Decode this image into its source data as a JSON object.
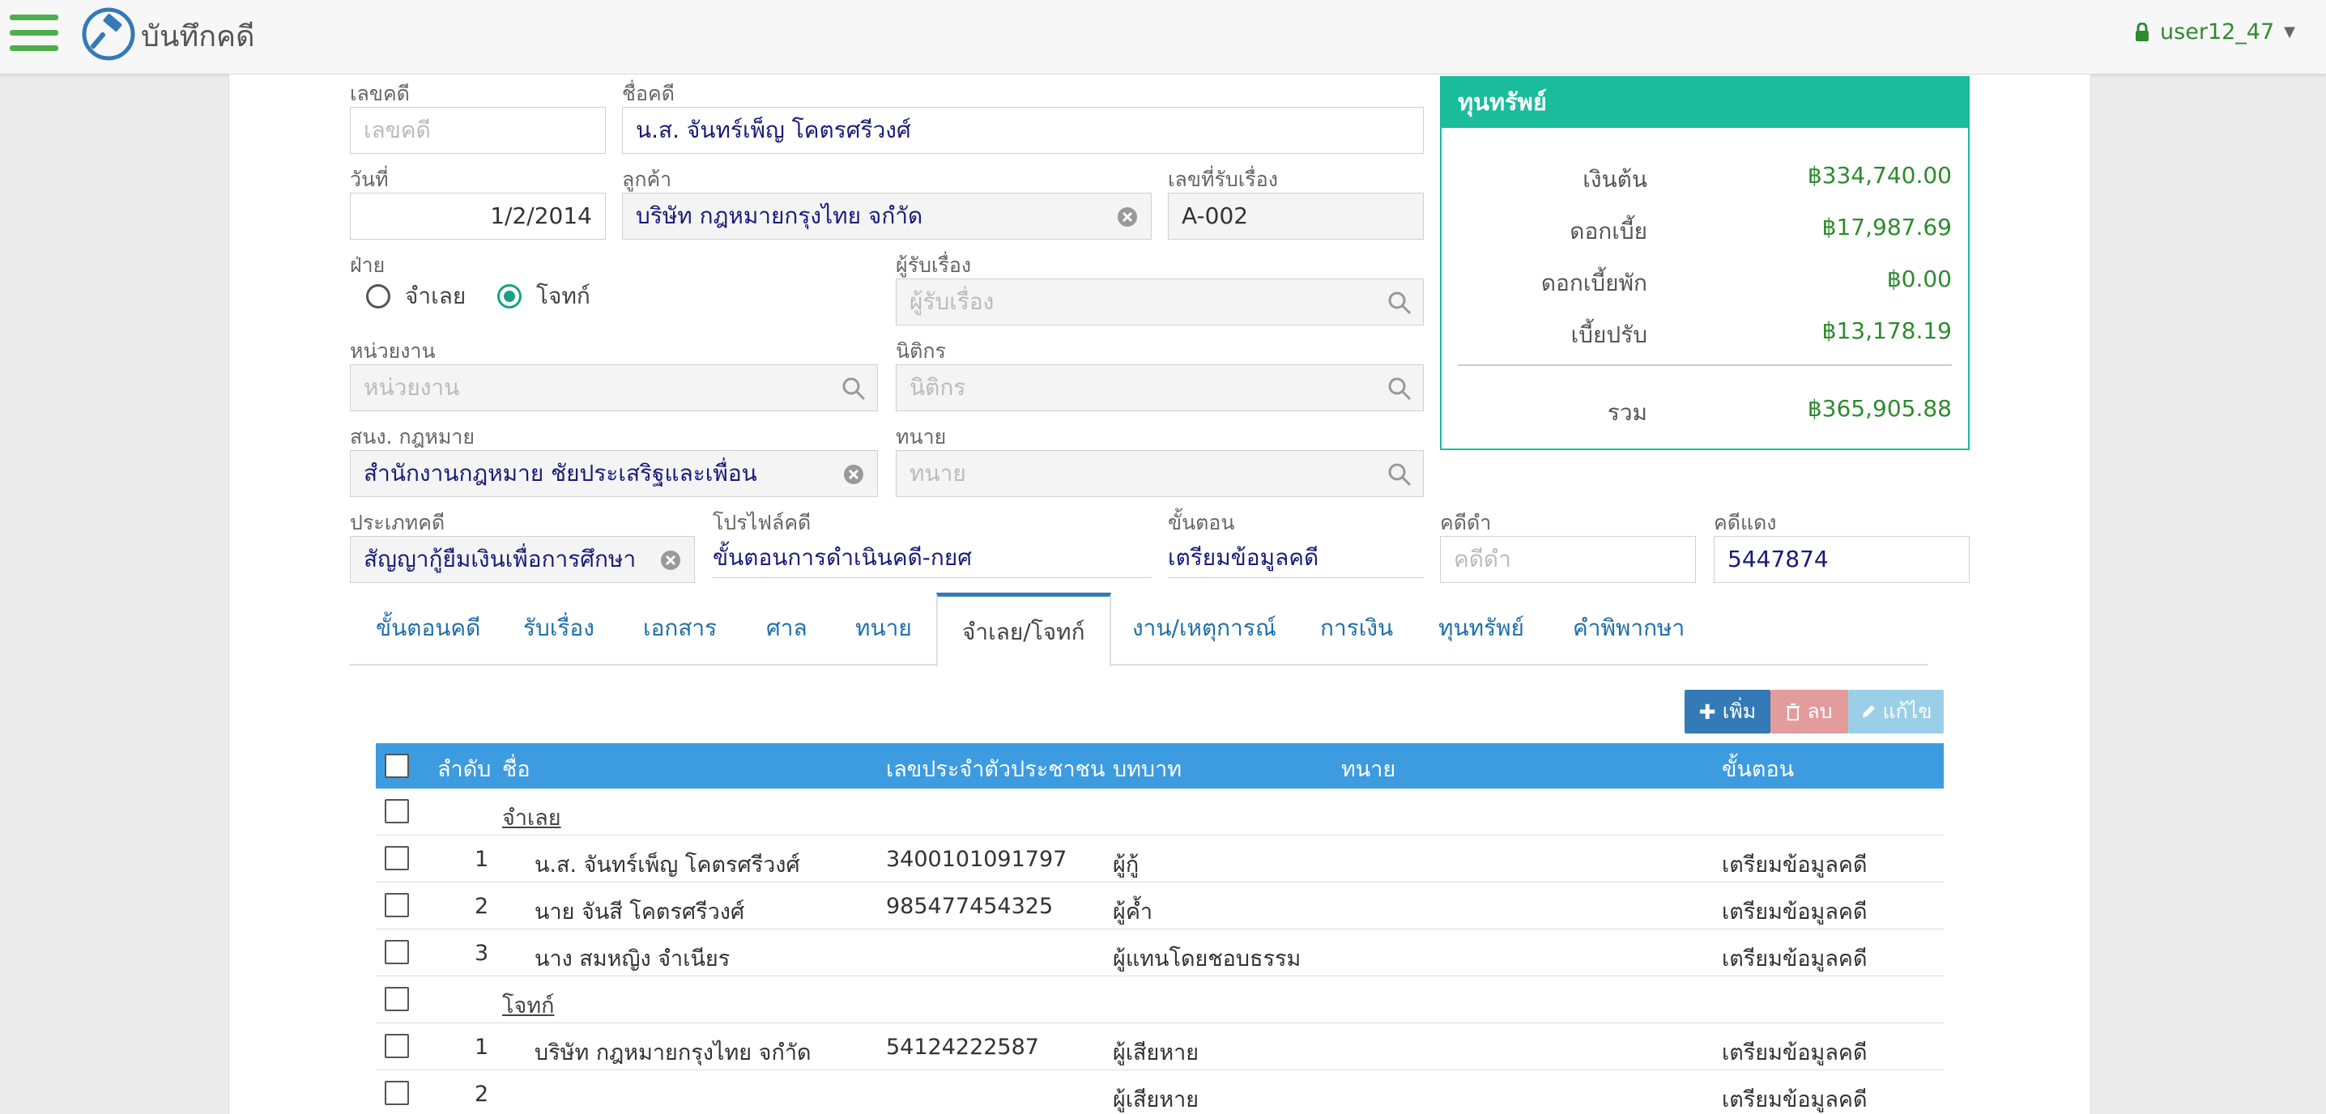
{
  "header": {
    "title": "บันทึกคดี",
    "user": "user12_47"
  },
  "form": {
    "case_no": {
      "label": "เลขคดี",
      "placeholder": "เลขคดี",
      "value": ""
    },
    "case_name": {
      "label": "ชื่อคดี",
      "value": "น.ส. จันทร์เพ็ญ โคตรศรีวงศ์"
    },
    "date": {
      "label": "วันที่",
      "value": "1/2/2014"
    },
    "client": {
      "label": "ลูกค้า",
      "value": "บริษัท กฎหมายกรุงไทย จกำัด"
    },
    "receive_no": {
      "label": "เลขที่รับเรื่อง",
      "value": "A-002"
    },
    "side": {
      "label": "ฝ่าย",
      "options": [
        "จำเลย",
        "โจทก์"
      ],
      "selected": "โจทก์"
    },
    "receiver": {
      "label": "ผู้รับเรื่อง",
      "placeholder": "ผู้รับเรื่อง"
    },
    "unit": {
      "label": "หน่วยงาน",
      "placeholder": "หน่วยงาน"
    },
    "legal_officer": {
      "label": "นิติกร",
      "placeholder": "นิติกร"
    },
    "law_office": {
      "label": "สนง. กฎหมาย",
      "value": "สำนักงานกฎหมาย ชัยประเสริฐและเพื่อน"
    },
    "lawyer": {
      "label": "ทนาย",
      "placeholder": "ทนาย"
    },
    "case_type": {
      "label": "ประเภทคดี",
      "value": "สัญญากู้ยืมเงินเพื่อการศึกษา"
    },
    "case_profile": {
      "label": "โปรไฟล์คดี",
      "value": "ขั้นตอนการดำเนินคดี-กยศ"
    },
    "step": {
      "label": "ขั้นตอน",
      "value": "เตรียมข้อมูลคดี"
    },
    "black_case": {
      "label": "คดีดำ",
      "placeholder": "คดีดำ"
    },
    "red_case": {
      "label": "คดีแดง",
      "value": "5447874"
    }
  },
  "assets": {
    "title": "ทุนทรัพย์",
    "rows": [
      {
        "label": "เงินต้น",
        "value": "฿334,740.00"
      },
      {
        "label": "ดอกเบี้ย",
        "value": "฿17,987.69"
      },
      {
        "label": "ดอกเบี้ยพัก",
        "value": "฿0.00"
      },
      {
        "label": "เบี้ยปรับ",
        "value": "฿13,178.19"
      }
    ],
    "total": {
      "label": "รวม",
      "value": "฿365,905.88"
    }
  },
  "tabs": [
    "ขั้นตอนคดี",
    "รับเรื่อง",
    "เอกสาร",
    "ศาล",
    "ทนาย",
    "จำเลย/โจทก์",
    "งาน/เหตุการณ์",
    "การเงิน",
    "ทุนทรัพย์",
    "คำพิพากษา"
  ],
  "active_tab": "จำเลย/โจทก์",
  "toolbar": {
    "add": "เพิ่ม",
    "delete": "ลบ",
    "edit": "แก้ไข"
  },
  "table": {
    "headers": [
      "ลำดับ",
      "ชื่อ",
      "เลขประจำตัวประชาชน",
      "บทบาท",
      "ทนาย",
      "ขั้นตอน"
    ],
    "rows": [
      {
        "group": "จำเลย"
      },
      {
        "no": "1",
        "name": "น.ส. จันทร์เพ็ญ โคตรศรีวงศ์",
        "id": "3400101091797",
        "role": "ผู้กู้",
        "lawyer": "",
        "step": "เตรียมข้อมูลคดี"
      },
      {
        "no": "2",
        "name": "นาย จันสี โคตรศรีวงศ์",
        "id": "985477454325",
        "role": "ผู้ค้ำ",
        "lawyer": "",
        "step": "เตรียมข้อมูลคดี"
      },
      {
        "no": "3",
        "name": "นาง สมหญิง จำเนียร",
        "id": "",
        "role": "ผู้แทนโดยชอบธรรม",
        "lawyer": "",
        "step": "เตรียมข้อมูลคดี"
      },
      {
        "group": "โจทก์"
      },
      {
        "no": "1",
        "name": "บริษัท กฎหมายกรุงไทย จกำัด",
        "id": "54124222587",
        "role": "ผู้เสียหาย",
        "lawyer": "",
        "step": "เตรียมข้อมูลคดี"
      },
      {
        "no": "2",
        "name": "",
        "id": "",
        "role": "ผู้เสียหาย",
        "lawyer": "",
        "step": "เตรียมข้อมูลคดี"
      }
    ]
  },
  "colors": {
    "accent": "#1abc9c",
    "header_bar": "#3d9be0",
    "add_btn": "#337ab7",
    "delete_btn": "#e49b9b",
    "edit_btn": "#9bcfe8",
    "brand_green": "#4cae4c"
  }
}
